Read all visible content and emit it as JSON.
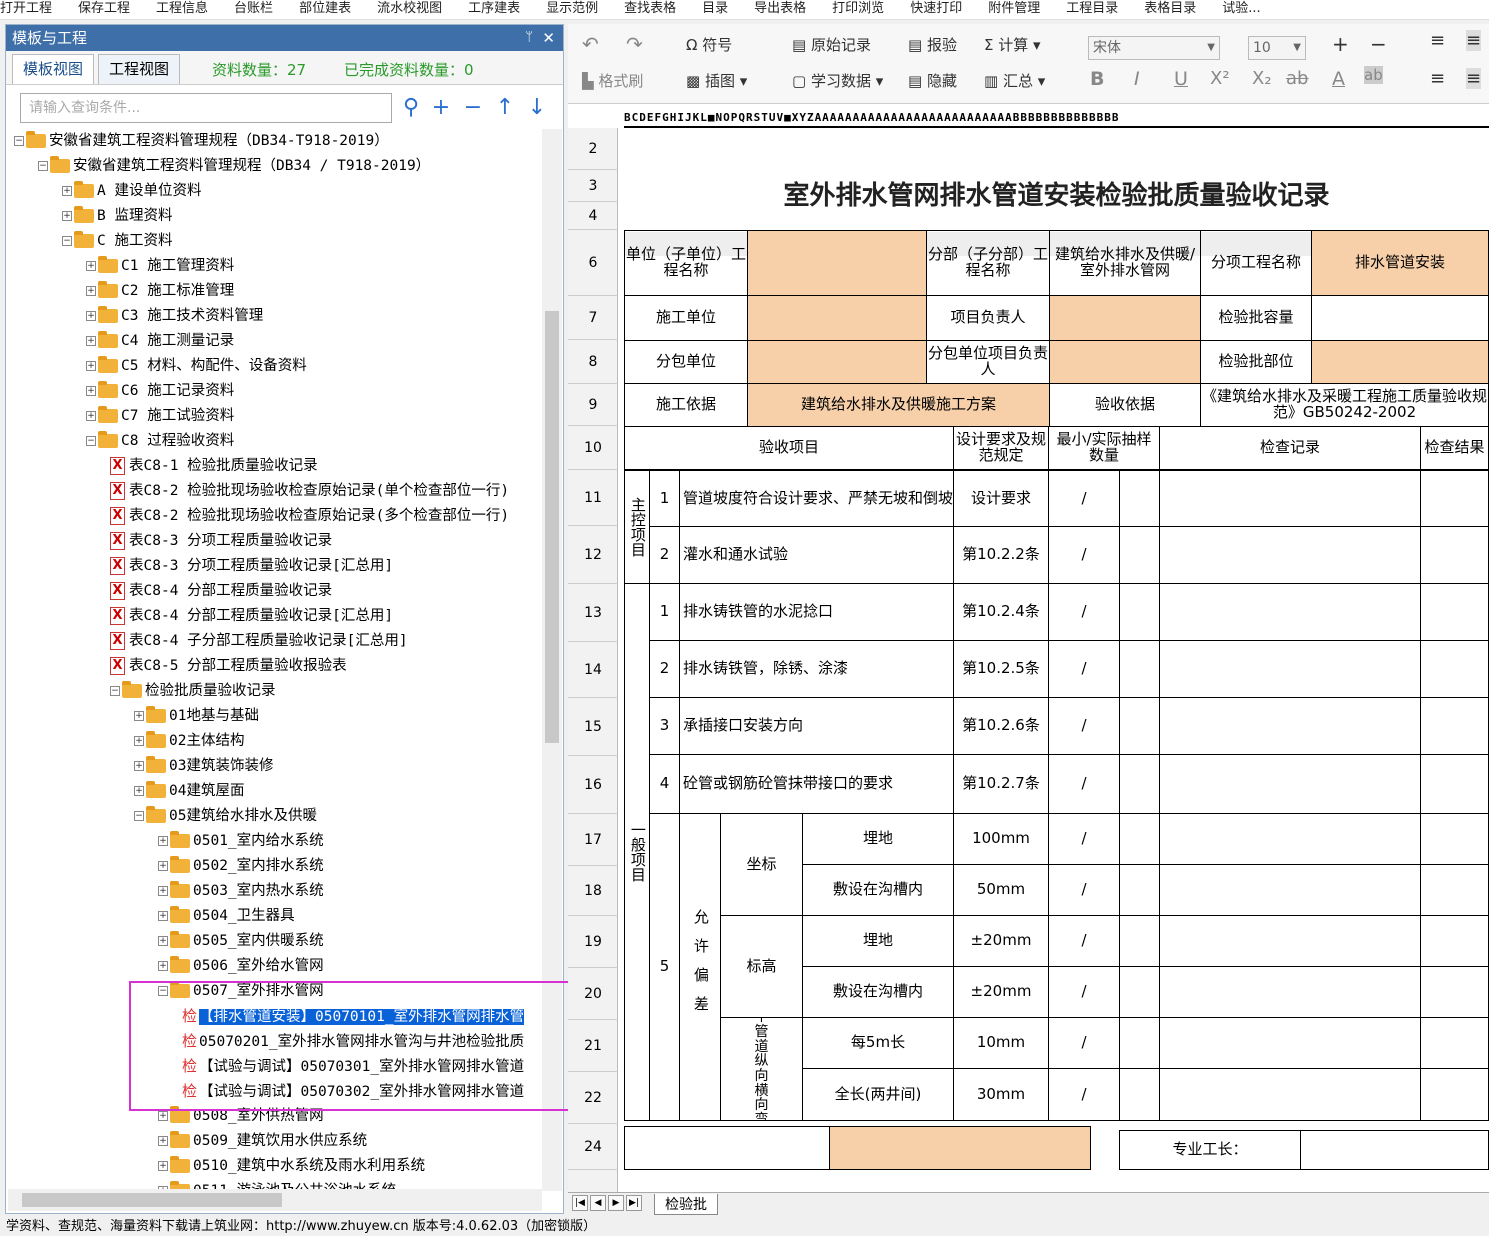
{
  "menu": [
    "打开工程",
    "保存工程",
    "工程信息",
    "台账栏",
    "部位建表",
    "流水校视图",
    "工序建表",
    "显示范例",
    "查找表格",
    "目录",
    "导出表格",
    "打印浏览",
    "快速打印",
    "附件管理",
    "工程目录",
    "表格目录",
    "试验..."
  ],
  "left_panel": {
    "title": "模板与工程",
    "pin": "ᛘ",
    "close": "✕",
    "tabs": [
      "模板视图",
      "工程视图"
    ],
    "data_count": "资料数量：27",
    "done_count": "已完成资料数量：0",
    "search_placeholder": "请输入查询条件...",
    "icons": [
      "search-icon",
      "plus-icon",
      "minus-icon",
      "up-arrow-icon",
      "down-arrow-icon"
    ],
    "tree": [
      "安徽省建筑工程资料管理规程（DB34-T918-2019）",
      "安徽省建筑工程资料管理规程（DB34 / T918-2019）",
      "A 建设单位资料",
      "B 监理资料",
      "C 施工资料",
      "C1 施工管理资料",
      "C2 施工标准管理",
      "C3 施工技术资料管理",
      "C4 施工测量记录",
      "C5 材料、构配件、设备资料",
      "C6 施工记录资料",
      "C7 施工试验资料",
      "C8 过程验收资料",
      "表C8-1 检验批质量验收记录",
      "表C8-2 检验批现场验收检查原始记录(单个检查部位一行)",
      "表C8-2 检验批现场验收检查原始记录(多个检查部位一行)",
      "表C8-3 分项工程质量验收记录",
      "表C8-3 分项工程质量验收记录[汇总用]",
      "表C8-4 分部工程质量验收记录",
      "表C8-4 分部工程质量验收记录[汇总用]",
      "表C8-4 子分部工程质量验收记录[汇总用]",
      "表C8-5 分部工程质量验收报验表",
      "检验批质量验收记录",
      "01地基与基础",
      "02主体结构",
      "03建筑装饰装修",
      "04建筑屋面",
      "05建筑给水排水及供暖",
      "0501_室内给水系统",
      "0502_室内排水系统",
      "0503_室内热水系统",
      "0504_卫生器具",
      "0505_室内供暖系统",
      "0506_室外给水管网",
      "0507_室外排水管网",
      "【排水管道安装】05070101_室外排水管网排水管",
      "05070201_室外排水管网排水管沟与井池检验批质",
      "【试验与调试】05070301_室外排水管网排水管道",
      "【试验与调试】05070302_室外排水管网排水管道",
      "0508_室外供热管网",
      "0509_建筑饮用水供应系统",
      "0510_建筑中水系统及雨水利用系统",
      "0511_游泳池及公共浴池水系统"
    ],
    "jian": "检"
  },
  "toolbar": {
    "undo": "↶",
    "redo": "↷",
    "symbol": "符号",
    "format_brush": "格式刷",
    "original_record": "原始记录",
    "image": "插图",
    "learn_data": "学习数据",
    "report": "报验",
    "hide": "隐藏",
    "calc": "计算",
    "summary": "汇总",
    "font": "宋体",
    "size": "10",
    "bold": "B",
    "italic": "I",
    "underline": "U",
    "sup": "X²",
    "sub": "X₂",
    "strike": "ab",
    "fontcolor": "A",
    "highlight": "ab"
  },
  "sheet": {
    "colhdr": "BCDEFGHIJKL■NOPQRSTUV■XYZAAAAAAAAAAAAAAAAAAAAAAAAAABBBBBBBBBBBBBB",
    "rows": [
      "2",
      "3",
      "4",
      "6",
      "7",
      "8",
      "9",
      "10",
      "11",
      "12",
      "13",
      "14",
      "15",
      "16",
      "17",
      "18",
      "19",
      "20",
      "21",
      "22",
      "24"
    ],
    "title": "室外排水管网排水管道安装检验批质量验收记录",
    "code": "05070101",
    "r6": [
      "单位（子单位）工程名称",
      "分部（子分部）工程名称",
      "建筑给水排水及供暖/室外排水管网",
      "分项工程名称",
      "排水管道安装"
    ],
    "r7": [
      "施工单位",
      "项目负责人",
      "检验批容量"
    ],
    "r8": [
      "分包单位",
      "分包单位项目负责人",
      "检验批部位"
    ],
    "r9": [
      "施工依据",
      "建筑给水排水及供暖施工方案",
      "验收依据",
      "《建筑给水排水及采暖工程施工质量验收规范》GB50242-2002"
    ],
    "r10": [
      "验收项目",
      "设计要求及规范规定",
      "最小/实际抽样数量",
      "检查记录",
      "检查结果"
    ],
    "main_label": "主控项目",
    "general_label": "一般项目",
    "items": [
      {
        "no": "1",
        "name": "管道坡度符合设计要求、严禁无坡和倒坡",
        "std": "设计要求"
      },
      {
        "no": "2",
        "name": "灌水和通水试验",
        "std": "第10.2.2条"
      },
      {
        "no": "1",
        "name": "排水铸铁管的水泥捻口",
        "std": "第10.2.4条"
      },
      {
        "no": "2",
        "name": "排水铸铁管，除锈、涂漆",
        "std": "第10.2.5条"
      },
      {
        "no": "3",
        "name": "承插接口安装方向",
        "std": "第10.2.6条"
      },
      {
        "no": "4",
        "name": "砼管或钢筋砼管抹带接口的要求",
        "std": "第10.2.7条"
      }
    ],
    "dev_no": "5",
    "dev_label": "允许偏差",
    "coord": "坐标",
    "elev": "标高",
    "slope": "水平管道纵向横向弯曲",
    "dev": [
      {
        "sub": "埋地",
        "std": "100mm"
      },
      {
        "sub": "敷设在沟槽内",
        "std": "50mm"
      },
      {
        "sub": "埋地",
        "std": "±20mm"
      },
      {
        "sub": "敷设在沟槽内",
        "std": "±20mm"
      },
      {
        "sub": "每5m长",
        "std": "10mm"
      },
      {
        "sub": "全长(两井间)",
        "std": "30mm"
      }
    ],
    "slash": "/",
    "foreman": "专业工长：",
    "tab_name": "检验批"
  },
  "status": "学资料、查规范、海量资料下载请上筑业网：http://www.zhuyew.cn   版本号:4.0.62.03（加密锁版）"
}
